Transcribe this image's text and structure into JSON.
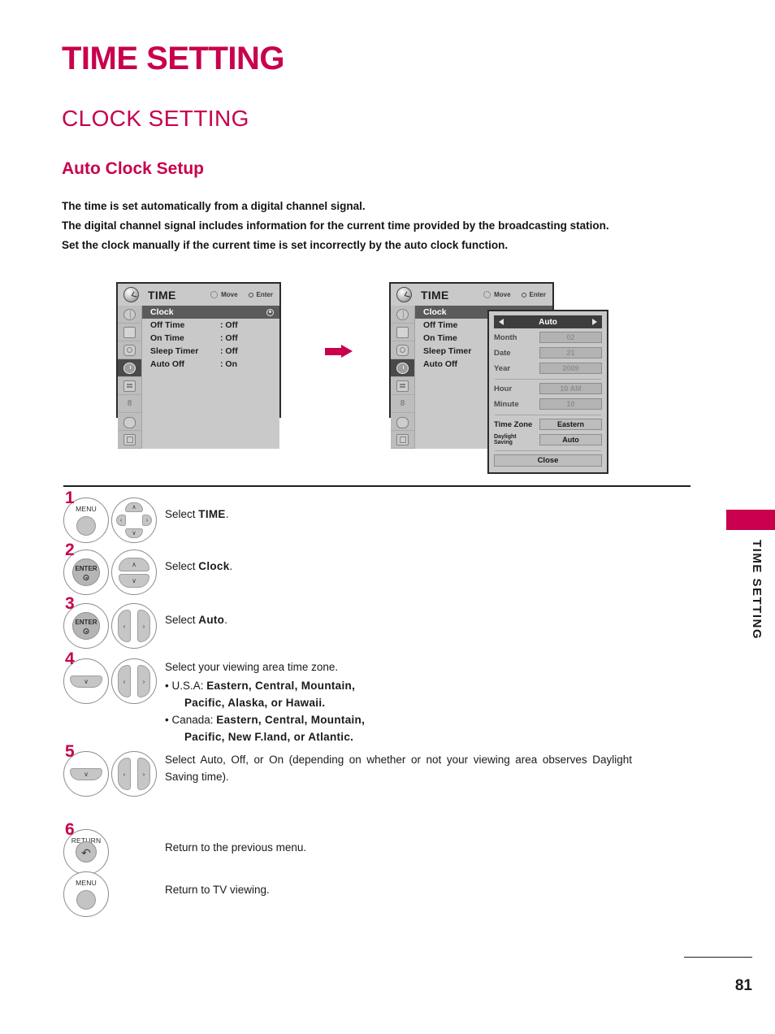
{
  "document": {
    "page_title": "TIME SETTING",
    "section_title": "CLOCK SETTING",
    "subsection_title": "Auto Clock Setup",
    "page_number": "81",
    "side_tab_label": "TIME SETTING",
    "accent_color": "#c8004e"
  },
  "intro": {
    "line1": "The time is set automatically from a digital channel signal.",
    "line2": "The digital channel signal includes information for the current time provided by the broadcasting station.",
    "line3": "Set the clock manually if the current time is set incorrectly by the auto clock function."
  },
  "menu_screen_1": {
    "title": "TIME",
    "hint_move": "Move",
    "hint_enter": "Enter",
    "rows": [
      {
        "label": "Clock",
        "value": "",
        "selected": true
      },
      {
        "label": "Off Time",
        "value": ": Off",
        "selected": false
      },
      {
        "label": "On Time",
        "value": ": Off",
        "selected": false
      },
      {
        "label": "Sleep Timer",
        "value": ": Off",
        "selected": false
      },
      {
        "label": "Auto Off",
        "value": ": On",
        "selected": false
      }
    ],
    "rail_icons": [
      "globe-icon",
      "screen-icon",
      "gear-icon",
      "clock-icon",
      "lock-icon",
      "number-icon",
      "usb-icon",
      "setup-icon"
    ]
  },
  "menu_screen_2": {
    "title": "TIME",
    "hint_move": "Move",
    "hint_enter": "Enter",
    "rows": [
      {
        "label": "Clock",
        "value": "",
        "selected": true
      },
      {
        "label": "Off Time",
        "value": "",
        "selected": false
      },
      {
        "label": "On Time",
        "value": "",
        "selected": false
      },
      {
        "label": "Sleep Timer",
        "value": "",
        "selected": false
      },
      {
        "label": "Auto Off",
        "value": "",
        "selected": false
      }
    ]
  },
  "clock_dialog": {
    "mode_label": "Auto",
    "fields": [
      {
        "name": "Month",
        "value": "02",
        "dimmed": true
      },
      {
        "name": "Date",
        "value": "21",
        "dimmed": true
      },
      {
        "name": "Year",
        "value": "2009",
        "dimmed": true
      },
      {
        "name": "Hour",
        "value": "10 AM",
        "dimmed": true
      },
      {
        "name": "Minute",
        "value": "10",
        "dimmed": true
      }
    ],
    "time_zone_label": "Time Zone",
    "time_zone_value": "Eastern",
    "daylight_label_line1": "Daylight",
    "daylight_label_line2": "Saving",
    "daylight_value": "Auto",
    "close_label": "Close"
  },
  "steps": [
    {
      "number": "1",
      "button_primary": "MENU",
      "button_secondary": "dpad",
      "text_prefix": "Select ",
      "text_bold": "TIME",
      "text_suffix": "."
    },
    {
      "number": "2",
      "button_primary": "ENTER",
      "button_secondary": "updown",
      "text_prefix": "Select ",
      "text_bold": "Clock",
      "text_suffix": "."
    },
    {
      "number": "3",
      "button_primary": "ENTER",
      "button_secondary": "leftright",
      "text_prefix": "Select ",
      "text_bold": "Auto",
      "text_suffix": "."
    },
    {
      "number": "4",
      "button_primary": "down",
      "button_secondary": "leftright",
      "heading": "Select your viewing area time zone.",
      "bullet_usa_prefix": "U.S.A: ",
      "bullet_usa_line1": "Eastern, Central, Mountain,",
      "bullet_usa_line2": "Pacific, Alaska, or Hawaii.",
      "bullet_canada_prefix": "Canada: ",
      "bullet_canada_line1": "Eastern, Central, Mountain,",
      "bullet_canada_line2": "Pacific, New F.land, or Atlantic."
    },
    {
      "number": "5",
      "button_primary": "down",
      "button_secondary": "leftright",
      "text": "Select Auto, Off, or On (depending on whether or not your viewing area observes Daylight Saving time)."
    },
    {
      "number": "6",
      "button_primary": "RETURN",
      "text": "Return to the previous menu."
    },
    {
      "number": "",
      "button_primary": "MENU",
      "text": "Return to TV viewing."
    }
  ],
  "step_labels": {
    "dpad_up": "∧",
    "dpad_down": "∨",
    "dpad_left": "‹",
    "dpad_right": "›"
  }
}
